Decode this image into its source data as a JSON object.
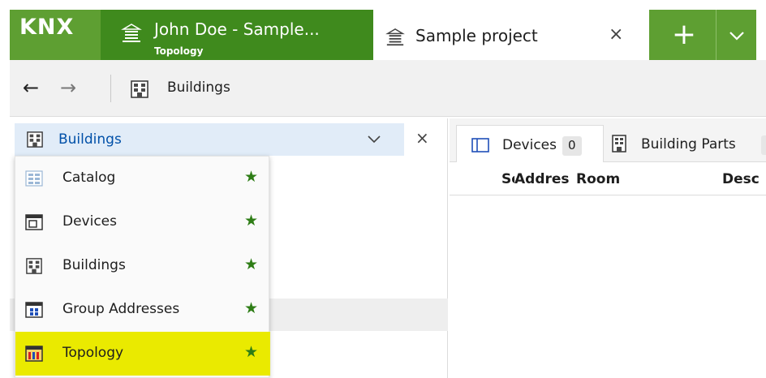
{
  "app": {
    "logo_text": "KNX",
    "doc_tab": {
      "title": "John Doe - Sample...",
      "subtitle": "Topology"
    },
    "active_tab": {
      "title": "Sample project",
      "close_label": "×"
    },
    "plus_label": "+",
    "dropdown_label": "⌵",
    "accent_green": "#5e9f32",
    "dark_green": "#3f8a1d"
  },
  "nav": {
    "back_label": "←",
    "forward_label": "→",
    "breadcrumb": "Buildings"
  },
  "left_panel": {
    "dropdown_label": "Buildings",
    "chevron": "⌵",
    "close_label": "×",
    "menu": [
      {
        "label": "Catalog",
        "icon": "catalog-icon",
        "star": "★",
        "selected": false
      },
      {
        "label": "Devices",
        "icon": "devices-icon",
        "star": "★",
        "selected": false
      },
      {
        "label": "Buildings",
        "icon": "buildings-icon",
        "star": "★",
        "selected": false
      },
      {
        "label": "Group Addresses",
        "icon": "group-addresses-icon",
        "star": "★",
        "selected": false
      },
      {
        "label": "Topology",
        "icon": "topology-icon",
        "star": "★",
        "selected": true
      }
    ]
  },
  "right_panel": {
    "tabs": [
      {
        "label": "Devices",
        "count": "0"
      },
      {
        "label": "Building Parts"
      }
    ],
    "columns": [
      "Se",
      "Addres",
      "Room",
      "Desc"
    ]
  }
}
